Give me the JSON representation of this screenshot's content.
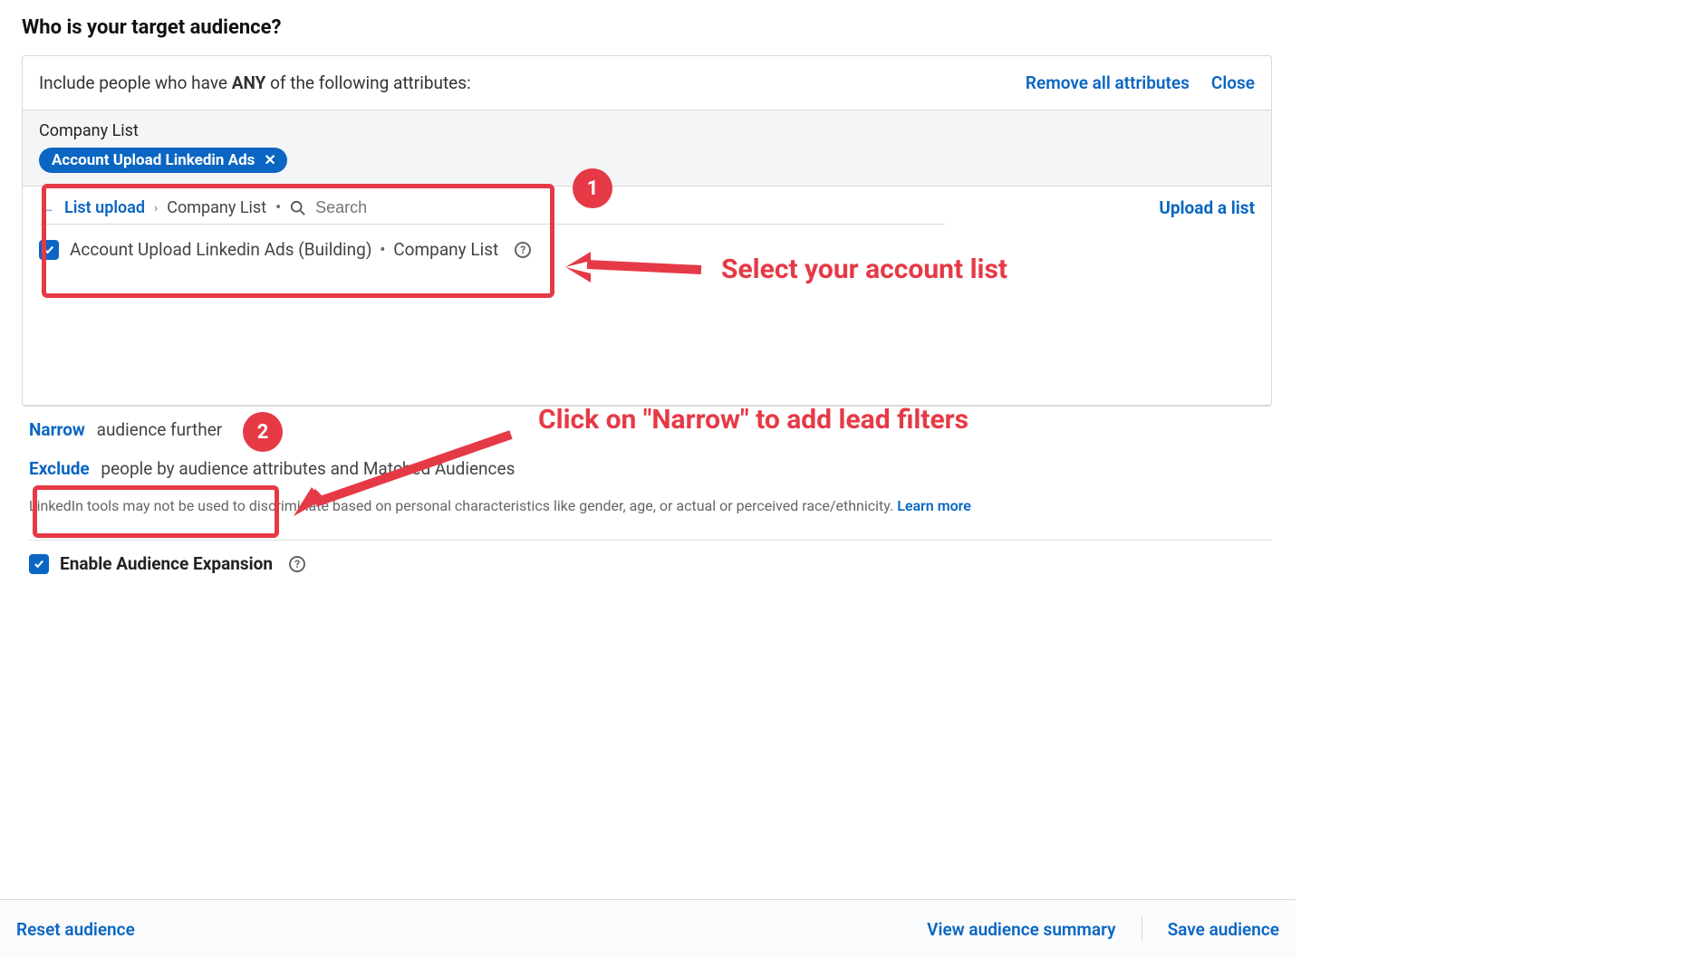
{
  "section_title": "Who is your target audience?",
  "header": {
    "prefix": "Include people who have ",
    "bold": "ANY",
    "suffix": " of the following attributes:",
    "remove_all": "Remove all attributes",
    "close": "Close"
  },
  "attr_block": {
    "label": "Company List",
    "chip": "Account Upload Linkedin Ads"
  },
  "breadcrumb": {
    "list_upload": "List upload",
    "company_list": "Company List",
    "search_placeholder": "Search",
    "upload_link": "Upload a list"
  },
  "option": {
    "label": "Account Upload Linkedin Ads (Building)",
    "type": "Company List"
  },
  "narrow": {
    "kw": "Narrow",
    "text": "audience further"
  },
  "exclude": {
    "kw": "Exclude",
    "text": "people by audience attributes and Matched Audiences"
  },
  "disclaimer": {
    "text": "LinkedIn tools may not be used to discriminate based on personal characteristics like gender, age, or actual or perceived race/ethnicity. ",
    "learn_more": "Learn more"
  },
  "expansion": {
    "label": "Enable Audience Expansion"
  },
  "footer": {
    "reset": "Reset audience",
    "view_summary": "View audience summary",
    "save": "Save audience"
  },
  "annotations": {
    "badge1": "1",
    "badge2": "2",
    "text1": "Select your account list",
    "text2": "Click on \"Narrow\" to add lead filters"
  }
}
